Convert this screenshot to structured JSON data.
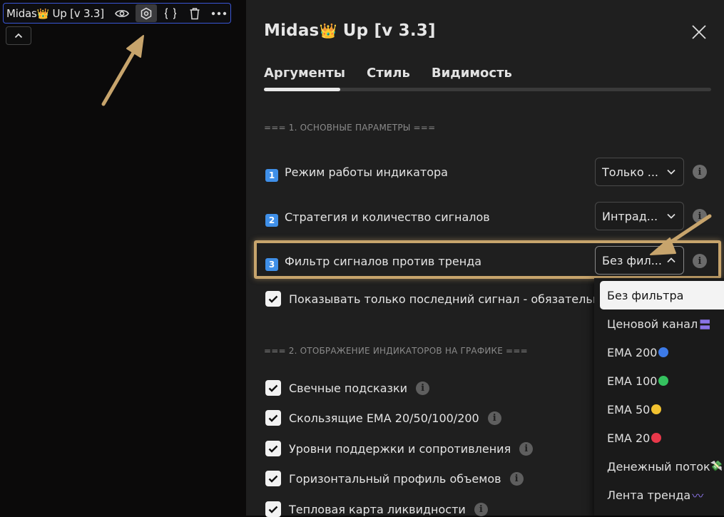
{
  "legend": {
    "name": "Midas",
    "crown": "👑",
    "name_suffix": "Up [v 3.3]"
  },
  "dialog": {
    "title_name": "Midas",
    "title_crown": "👑",
    "title_suffix": "Up [v 3.3]",
    "tabs": [
      {
        "label": "Аргументы"
      },
      {
        "label": "Стиль"
      },
      {
        "label": "Видимость"
      }
    ],
    "sections": [
      {
        "header": "=== 1. ОСНОВНЫЕ ПАРАМЕТРЫ ==="
      },
      {
        "header": "=== 2. ОТОБРАЖЕНИЕ ИНДИКАТОРОВ НА ГРАФИКЕ ==="
      }
    ],
    "params": [
      {
        "badge": "1",
        "label": "Режим работы индикатора",
        "value": "Только ..."
      },
      {
        "badge": "2",
        "label": "Стратегия и количество сигналов",
        "value": "Интрад..."
      },
      {
        "badge": "3",
        "label": "Фильтр сигналов против тренда",
        "value": "Без фил..."
      }
    ],
    "last_signal_label": "Показывать только последний сигнал - обязательно",
    "checks": [
      {
        "label": "Свечные подсказки",
        "checked": true
      },
      {
        "label": "Скользящие EMA 20/50/100/200",
        "checked": true
      },
      {
        "label": "Уровни поддержки и сопротивления",
        "checked": true
      },
      {
        "label": "Горизонтальный профиль объемов",
        "checked": true
      },
      {
        "label": "Тепловая карта ликвидности",
        "checked": true
      }
    ],
    "info_glyph": "i"
  },
  "dropdown": {
    "options": [
      {
        "label": "Без фильтра",
        "selected": true,
        "emoji": ""
      },
      {
        "label": "Ценовой канал",
        "selected": false,
        "emoji": "〓"
      },
      {
        "label": "EMA 200",
        "selected": false,
        "dot_color": "#3d7be8"
      },
      {
        "label": "EMA 100",
        "selected": false,
        "dot_color": "#35c25f"
      },
      {
        "label": "EMA 50",
        "selected": false,
        "dot_color": "#f2c230"
      },
      {
        "label": "EMA 20",
        "selected": false,
        "dot_color": "#e8384a"
      },
      {
        "label": "Денежный поток",
        "selected": false,
        "emoji": "💸"
      },
      {
        "label": "Лента тренда",
        "selected": false,
        "emoji": "〰"
      }
    ]
  },
  "colors": {
    "accent_highlight": "#c7a46c",
    "legend_border": "#3a56d6",
    "badge_blue": "#3f8fe8"
  }
}
